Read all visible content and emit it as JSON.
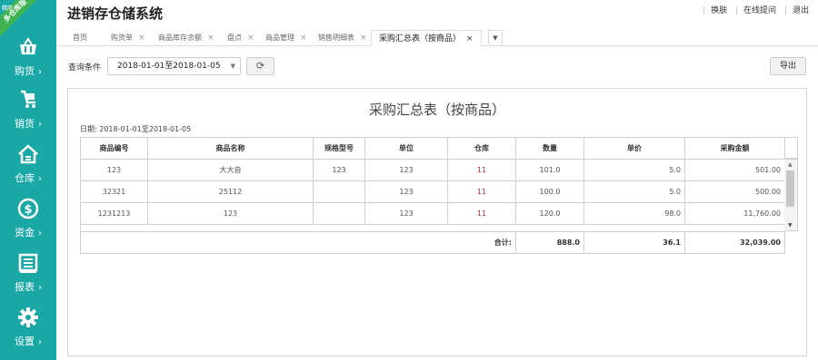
{
  "brand": {
    "ribbon": "多仓库版",
    "ribbon_small": "精简"
  },
  "header": {
    "title": "进销存仓储系统",
    "links": [
      "换肤",
      "在线提问",
      "退出"
    ]
  },
  "sidebar": {
    "items": [
      {
        "label": "购货",
        "icon": "shopping-basket-icon"
      },
      {
        "label": "销货",
        "icon": "cart-icon"
      },
      {
        "label": "仓库",
        "icon": "house-icon"
      },
      {
        "label": "资金",
        "icon": "dollar-icon"
      },
      {
        "label": "报表",
        "icon": "report-icon"
      },
      {
        "label": "设置",
        "icon": "gear-icon"
      }
    ],
    "chevron": "›"
  },
  "tabs": [
    {
      "label": "首页"
    },
    {
      "label": "购货单"
    },
    {
      "label": "商品库存余额"
    },
    {
      "label": "盘点"
    },
    {
      "label": "商品管理"
    },
    {
      "label": "销售明细表"
    },
    {
      "label": "采购汇总表（按商品）",
      "active": true
    }
  ],
  "query": {
    "label": "查询条件",
    "date_range": "2018-01-01至2018-01-05",
    "export_label": "导出"
  },
  "report": {
    "title": "采购汇总表（按商品）",
    "date_text": "日期: 2018-01-01至2018-01-05",
    "columns": [
      "商品编号",
      "商品名称",
      "规格型号",
      "单位",
      "仓库",
      "数量",
      "单价",
      "采购金额"
    ],
    "rows": [
      [
        "123",
        "大大自",
        "123",
        "123",
        "11",
        "101.0",
        "5.0",
        "501.00"
      ],
      [
        "32321",
        "25112",
        "",
        "123",
        "11",
        "100.0",
        "5.0",
        "500.00"
      ],
      [
        "1231213",
        "123",
        "",
        "123",
        "11",
        "120.0",
        "98.0",
        "11,760.00"
      ]
    ],
    "totals": {
      "label": "合计:",
      "quantity": "888.0",
      "price": "36.1",
      "amount": "32,039.00"
    }
  },
  "colors": {
    "sidebar": "#1aa8a6",
    "ribbon": "#3fb34f",
    "warehouse_text": "#b03030"
  }
}
